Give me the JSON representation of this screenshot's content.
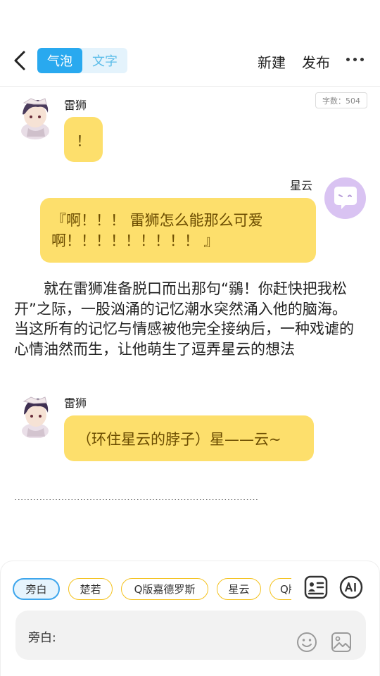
{
  "toolbar": {
    "mode_tabs": [
      "气泡",
      "文字"
    ],
    "new_label": "新建",
    "publish_label": "发布"
  },
  "word_count": "字数：504",
  "messages": [
    {
      "speaker": "雷狮",
      "text": "！"
    },
    {
      "speaker": "星云",
      "text_line1": "『啊！！！ 雷狮怎么能那么可爱",
      "text_line2": "啊！！！！！！！！！ 』"
    },
    {
      "speaker": "雷狮",
      "text": "（环住星云的脖子）星——云~"
    }
  ],
  "narration": "就在雷狮准备脱口而出那句“鶸！你赶快把我松开”之际，一股汹涌的记忆潮水突然涌入他的脑海。当这所有的记忆与情感被他完全接纳后，一种戏谑的心情油然而生，让他萌生了逗弄星云的想法",
  "ellipsis": "..............................................................................",
  "characters": [
    "旁白",
    "楚若",
    "Q版嘉德罗斯",
    "星云",
    "Q版"
  ],
  "input": {
    "label": "旁白:",
    "value": ""
  },
  "icons": {
    "back": "chevron-left-icon",
    "more": "more-dots-icon",
    "role_card": "role-card-icon",
    "ai": "ai-icon",
    "emoji": "emoji-icon",
    "image": "image-icon"
  },
  "colors": {
    "accent": "#29a9ef",
    "bubble": "#fddf6c",
    "chip_border": "#f4c21e"
  }
}
